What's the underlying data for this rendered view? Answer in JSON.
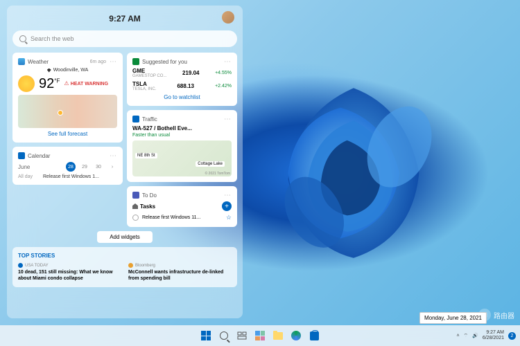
{
  "panel": {
    "time": "9:27 AM",
    "search_placeholder": "Search the web"
  },
  "weather": {
    "title": "Weather",
    "updated": "6m ago",
    "location": "Woodinville, WA",
    "temp": "92",
    "unit": "°F",
    "alert_icon": "⚠",
    "alert": "HEAT WARNING",
    "link": "See full forecast"
  },
  "calendar": {
    "title": "Calendar",
    "month": "June",
    "days": [
      "28",
      "29",
      "30"
    ],
    "active_day": "28",
    "all_day": "All day",
    "event": "Release first Windows 1..."
  },
  "suggested": {
    "title": "Suggested for you",
    "stocks": [
      {
        "sym": "GME",
        "name": "GAMESTOP CO...",
        "price": "219.04",
        "chg": "+4.55%"
      },
      {
        "sym": "TSLA",
        "name": "TESLA, INC.",
        "price": "688.13",
        "chg": "+2.42%"
      }
    ],
    "link": "Go to watchlist"
  },
  "traffic": {
    "title": "Traffic",
    "route": "WA-527 / Bothell Eve...",
    "status": "Faster than usual",
    "label1": "NE 8th St",
    "label2": "Cottage Lake",
    "copy": "© 2021 TomTom"
  },
  "todo": {
    "title": "To Do",
    "section": "Tasks",
    "item": "Release first Windows 11..."
  },
  "add_widgets": "Add widgets",
  "news": {
    "title": "TOP STORIES",
    "items": [
      {
        "src": "USA TODAY",
        "color": "#0067c0",
        "head": "10 dead, 151 still missing: What we know about Miami condo collapse"
      },
      {
        "src": "Bloomberg",
        "color": "#e8a030",
        "head": "McConnell wants infrastructure de-linked from spending bill"
      }
    ]
  },
  "tooltip": "Monday, June 28, 2021",
  "tray": {
    "time": "9:27 AM",
    "date": "6/28/2021",
    "notif": "2"
  },
  "watermark": "路由器"
}
